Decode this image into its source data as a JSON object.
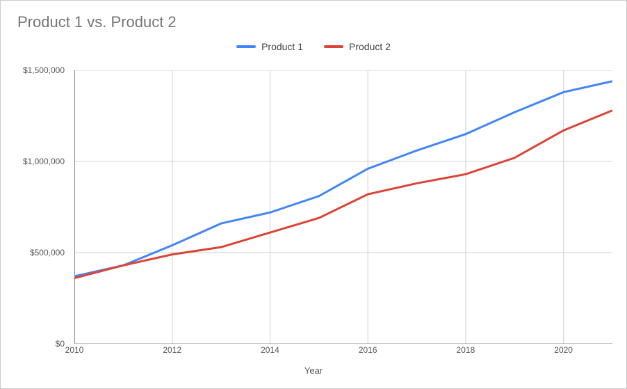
{
  "chart_data": {
    "type": "line",
    "title": "Product 1 vs. Product 2",
    "xlabel": "Year",
    "ylabel": "",
    "categories": [
      2010,
      2011,
      2012,
      2013,
      2014,
      2015,
      2016,
      2017,
      2018,
      2019,
      2020,
      2021
    ],
    "x_tick_labels": [
      "2010",
      "2012",
      "2014",
      "2016",
      "2018",
      "2020"
    ],
    "x_tick_values": [
      2010,
      2012,
      2014,
      2016,
      2018,
      2020
    ],
    "y_tick_labels": [
      "$0",
      "$500,000",
      "$1,000,000",
      "$1,500,000"
    ],
    "y_tick_values": [
      0,
      500000,
      1000000,
      1500000
    ],
    "xlim": [
      2010,
      2021
    ],
    "ylim": [
      0,
      1500000
    ],
    "series": [
      {
        "name": "Product 1",
        "color": "#4285F4",
        "values": [
          370000,
          430000,
          540000,
          660000,
          720000,
          810000,
          960000,
          1060000,
          1150000,
          1270000,
          1380000,
          1440000
        ]
      },
      {
        "name": "Product 2",
        "color": "#DB4437",
        "values": [
          360000,
          430000,
          490000,
          530000,
          610000,
          690000,
          820000,
          880000,
          930000,
          1020000,
          1170000,
          1280000
        ]
      }
    ],
    "grid": true,
    "legend_position": "top"
  }
}
